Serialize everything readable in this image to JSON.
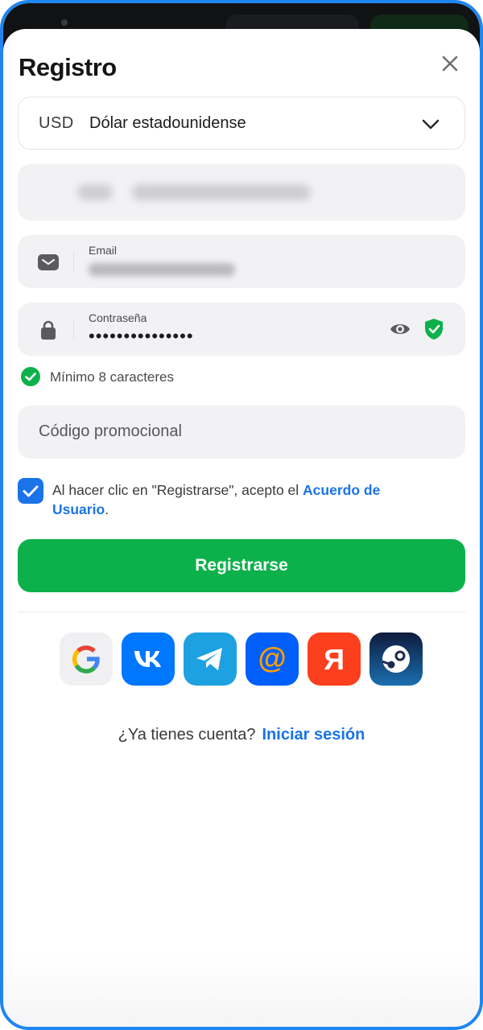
{
  "header": {
    "title": "Registro"
  },
  "currency": {
    "code": "USD",
    "name": "Dólar estadounidense"
  },
  "email": {
    "label": "Email"
  },
  "password": {
    "label": "Contraseña",
    "masked_value": "•••••••••••••••"
  },
  "password_hint": "Mínimo 8 caracteres",
  "promo": {
    "placeholder": "Código promocional"
  },
  "agreement": {
    "checked": true,
    "text": "Al hacer clic en \"Registrarse\", acepto el ",
    "link": "Acuerdo de Usuario",
    "suffix": "."
  },
  "submit_label": "Registrarse",
  "social_providers": [
    "google-icon",
    "vk-icon",
    "telegram-icon",
    "mail-ru-icon",
    "yandex-icon",
    "steam-icon"
  ],
  "login_prompt": {
    "text": "¿Ya tienes cuenta?",
    "link": "Iniciar sesión"
  },
  "colors": {
    "accent": "#1a73e8",
    "primary_button": "#0db14b",
    "frame": "#1f86f0",
    "success": "#0db14b"
  }
}
